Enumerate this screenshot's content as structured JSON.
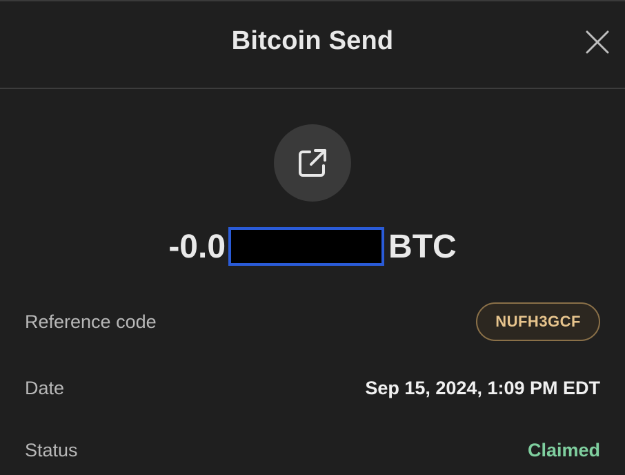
{
  "header": {
    "title": "Bitcoin Send"
  },
  "amount": {
    "prefix": "-0.0",
    "unit": "BTC"
  },
  "details": {
    "reference_label": "Reference code",
    "reference_value": "NUFH3GCF",
    "date_label": "Date",
    "date_value": "Sep 15, 2024, 1:09 PM EDT",
    "status_label": "Status",
    "status_value": "Claimed"
  },
  "colors": {
    "background": "#1f1f1f",
    "status_green": "#7fcf9f",
    "badge_gold": "#e7c48d",
    "redaction_border": "#2a5bd7"
  },
  "icons": {
    "close": "close-icon",
    "action": "external-link-icon"
  }
}
